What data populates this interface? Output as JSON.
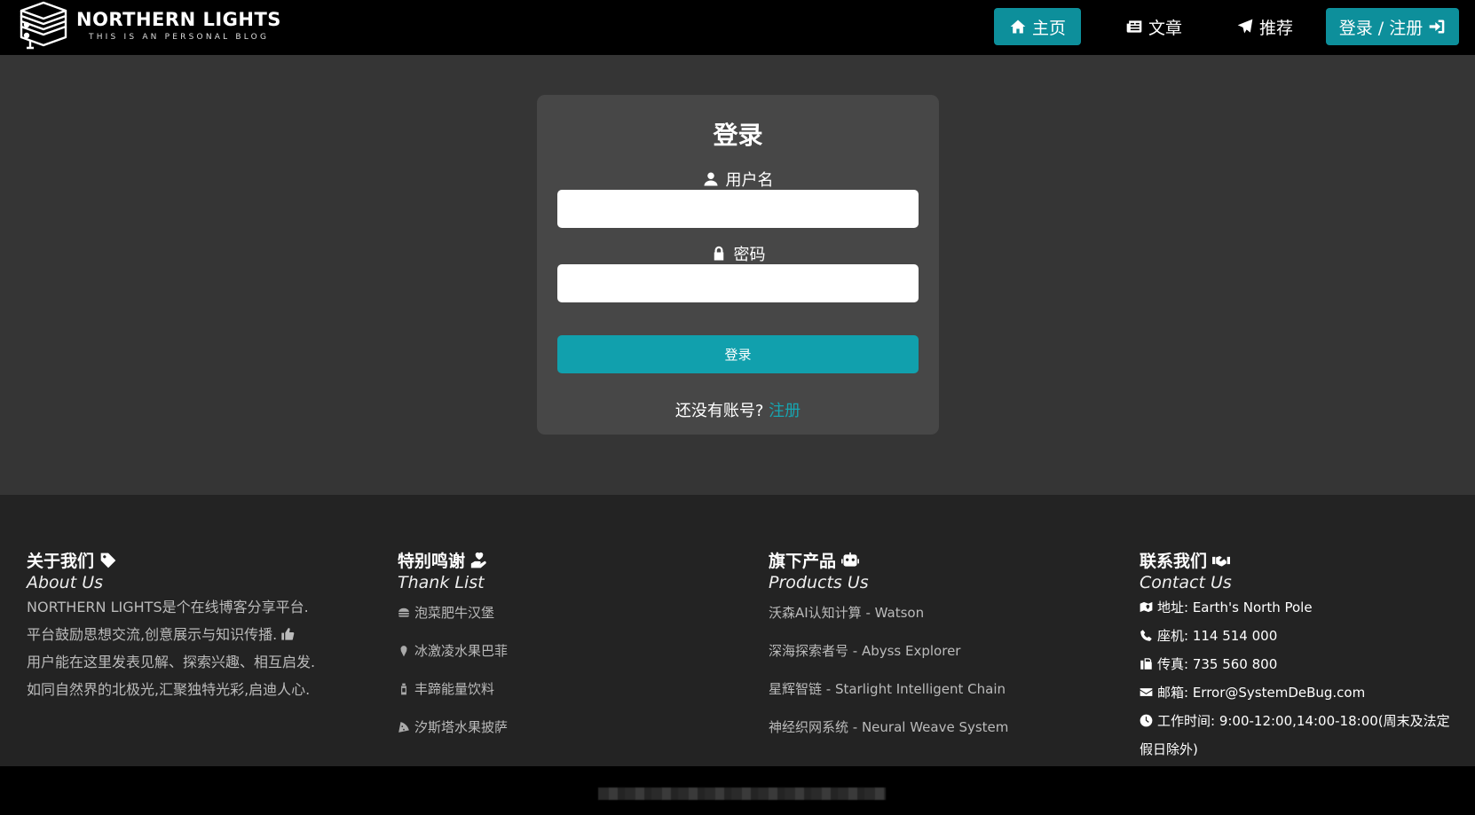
{
  "brand": {
    "title": "NORTHERN LIGHTS",
    "subtitle": "THIS IS AN PERSONAL BLOG"
  },
  "nav": {
    "home": "主页",
    "articles": "文章",
    "recommend": "推荐",
    "login_register": "登录 / 注册"
  },
  "login": {
    "title": "登录",
    "username_label": "用户名",
    "username_value": "",
    "password_label": "密码",
    "password_value": "",
    "submit": "登录",
    "no_account": "还没有账号?",
    "register_link": "注册"
  },
  "footer": {
    "about": {
      "title": "关于我们",
      "subtitle": "About Us",
      "line1": "NORTHERN LIGHTS是个在线博客分享平台.",
      "line2": "平台鼓励思想交流,创意展示与知识传播.",
      "line3": "用户能在这里发表见解、探索兴趣、相互启发.",
      "line4": "如同自然界的北极光,汇聚独特光彩,启迪人心."
    },
    "thanks": {
      "title": "特别鸣谢",
      "subtitle": "Thank List",
      "items": [
        "泡菜肥牛汉堡",
        "冰激凌水果巴菲",
        "丰蹄能量饮料",
        "汐斯塔水果披萨"
      ]
    },
    "products": {
      "title": "旗下产品",
      "subtitle": "Products Us",
      "items": [
        "沃森AI认知计算 - Watson",
        "深海探索者号 - Abyss Explorer",
        "星辉智链 - Starlight Intelligent Chain",
        "神经织网系统 - Neural Weave System"
      ]
    },
    "contact": {
      "title": "联系我们",
      "subtitle": "Contact Us",
      "address": "地址: Earth's North Pole",
      "phone": "座机: 114 514 000",
      "fax": "传真: 735 560 800",
      "email": "邮箱: Error@SystemDeBug.com",
      "hours": "工作时间: 9:00-12:00,14:00-18:00(周末及法定假日除外)"
    }
  },
  "colors": {
    "accent": "#0d8f9b",
    "button": "#11a0ad",
    "link": "#17a5b1"
  }
}
